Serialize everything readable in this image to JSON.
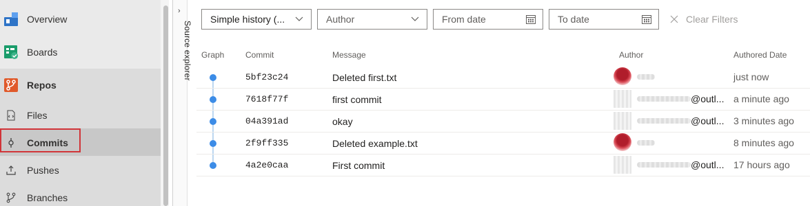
{
  "nav": {
    "items": [
      {
        "label": "Overview",
        "icon": "overview-icon"
      },
      {
        "label": "Boards",
        "icon": "boards-icon"
      },
      {
        "label": "Repos",
        "icon": "repos-icon"
      },
      {
        "label": "Files",
        "icon": "files-icon"
      },
      {
        "label": "Commits",
        "icon": "commits-icon"
      },
      {
        "label": "Pushes",
        "icon": "pushes-icon"
      },
      {
        "label": "Branches",
        "icon": "branches-icon"
      }
    ],
    "selected": "Commits",
    "highlight_color": "#d13438"
  },
  "source_explorer": {
    "label": "Source explorer"
  },
  "filters": {
    "history_mode": "Simple history (...",
    "author_placeholder": "Author",
    "from_placeholder": "From date",
    "to_placeholder": "To date",
    "clear_label": "Clear Filters"
  },
  "table": {
    "columns": {
      "graph": "Graph",
      "commit": "Commit",
      "message": "Message",
      "author": "Author",
      "date": "Authored Date"
    },
    "rows": [
      {
        "commit": "5bf23c24",
        "message": "Deleted first.txt",
        "author_suffix": "",
        "date": "just now",
        "avatar": "red"
      },
      {
        "commit": "7618f77f",
        "message": "first commit",
        "author_suffix": "@outl...",
        "date": "a minute ago",
        "avatar": "grey"
      },
      {
        "commit": "04a391ad",
        "message": "okay",
        "author_suffix": "@outl...",
        "date": "3 minutes ago",
        "avatar": "grey"
      },
      {
        "commit": "2f9ff335",
        "message": "Deleted example.txt",
        "author_suffix": "",
        "date": "8 minutes ago",
        "avatar": "red"
      },
      {
        "commit": "4a2e0caa",
        "message": "First commit",
        "author_suffix": "@outl...",
        "date": "17 hours ago",
        "avatar": "grey"
      }
    ]
  },
  "colors": {
    "graph_dot": "#3c8ce7",
    "accent": "#0078d4"
  }
}
